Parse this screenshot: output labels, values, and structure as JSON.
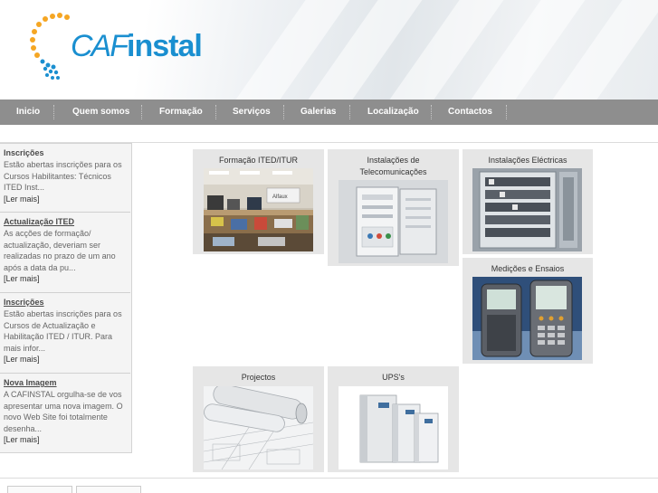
{
  "brand": {
    "logo_prefix": "CAF",
    "logo_suffix": "instal"
  },
  "nav": {
    "items": [
      {
        "label": "Inicio"
      },
      {
        "label": "Quem somos"
      },
      {
        "label": "Formação"
      },
      {
        "label": "Serviços"
      },
      {
        "label": "Galerias"
      },
      {
        "label": "Localização"
      },
      {
        "label": "Contactos"
      }
    ]
  },
  "sidebar": {
    "news": [
      {
        "title": "Inscrições",
        "body": "Estão abertas inscrições para os Cursos Habilitantes: Técnicos ITED Inst...",
        "more": "[Ler mais]"
      },
      {
        "title": "Actualização ITED",
        "body": "As acções de formação/ actualização, deveriam ser realizadas no prazo de um ano após a data da pu...",
        "more": "[Ler mais]"
      },
      {
        "title": "Inscrições",
        "body": "Estão abertas inscrições para os Cursos de Actualização e Habilitação ITED / ITUR. Para mais infor...",
        "more": "[Ler mais]"
      },
      {
        "title": "Nova Imagem",
        "body": "A CAFINSTAL orgulha-se de vos apresentar uma nova imagem. O novo Web Site foi totalmente desenha...",
        "more": "[Ler mais]"
      }
    ]
  },
  "tiles": {
    "formacao": {
      "title": "Formação ITED/ITUR",
      "image": "training-room-photo"
    },
    "telecom": {
      "title_line1": "Instalações de",
      "title_line2": "Telecomunicações",
      "image": "telecom-cabinet-photo"
    },
    "electricas": {
      "title": "Instalações Eléctricas",
      "image": "electrical-panel-photo"
    },
    "medicoes": {
      "title": "Medições e Ensaios",
      "image": "test-meters-photo"
    },
    "projectos": {
      "title": "Projectos",
      "image": "blueprints-photo"
    },
    "ups": {
      "title": "UPS's",
      "image": "ups-units-photo"
    }
  },
  "colors": {
    "nav_bg": "#8e8e8e",
    "logo_blue": "#1a8fd0",
    "logo_orange": "#f5a623",
    "tile_bg": "#e6e6e6"
  }
}
